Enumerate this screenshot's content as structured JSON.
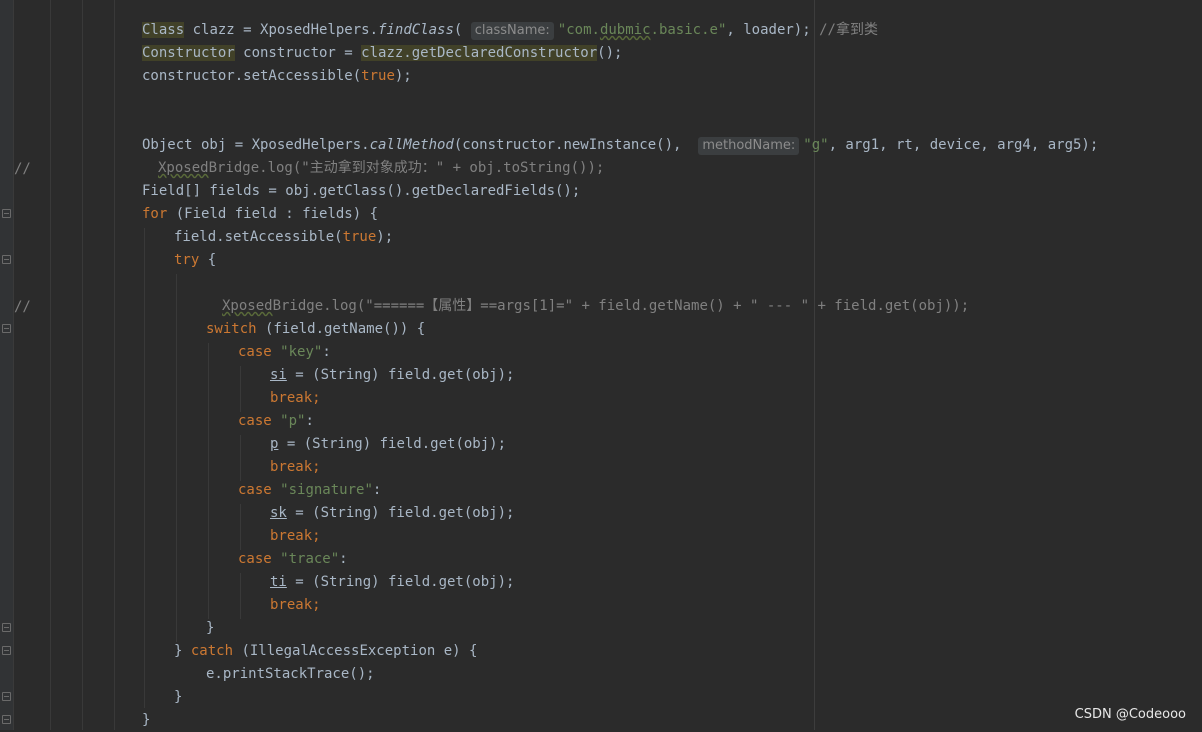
{
  "editor": {
    "gutter_comments": [
      "//",
      "//"
    ],
    "lines": {
      "l1": {
        "t1": "Class",
        "t2": " clazz = XposedHelpers.",
        "t3": "findClass",
        "t4": "(",
        "hint": "className:",
        "t5": "\"com.",
        "t6": "dubmic",
        ".basic.e\"": "",
        "t7": ".basic.e\"",
        "t8": ", loader); ",
        "t9": "//拿到类"
      },
      "l2": {
        "t1": "Constructor",
        "t2": " constructor = ",
        "t3": "clazz.getDeclaredConstructor",
        "t4": "();"
      },
      "l3": {
        "t1": "constructor.setAccessible(",
        "t2": "true",
        "t3": ");"
      },
      "l4": {
        "t1": "Object obj = XposedHelpers.",
        "t2": "callMethod",
        "t3": "(constructor.newInstance(), ",
        "hint": "methodName:",
        "t4": "\"g\"",
        "t5": ", arg1, rt, device, arg4, arg5);"
      },
      "l5": {
        "t1": "Xposed",
        "t2": "Bridge.log(\"主动拿到对象成功：\" + obj.toString());"
      },
      "l6": {
        "t1": "Field[] fields = obj.getClass().getDeclaredFields();"
      },
      "l7": {
        "t1": "for",
        "t2": " (Field field : fields) {"
      },
      "l8": {
        "t1": "field.setAccessible(",
        "t2": "true",
        "t3": ");"
      },
      "l9": {
        "t1": "try",
        "t2": " {"
      },
      "l10": {
        "t1": "Xposed",
        "t2": "Bridge.log(\"======【属性】==args[1]=\" + field.getName() + \" --- \" + field.get(obj));"
      },
      "l11": {
        "t1": "switch",
        "t2": " (field.getName()) {"
      },
      "l12": {
        "t1": "case ",
        "t2": "\"key\"",
        "t3": ":"
      },
      "l13": {
        "t1": "si",
        "t2": " = (String) field.get(obj);"
      },
      "l14": {
        "t1": "break;"
      },
      "l15": {
        "t1": "case ",
        "t2": "\"p\"",
        "t3": ":"
      },
      "l16": {
        "t1": "p",
        "t2": " = (String) field.get(obj);"
      },
      "l17": {
        "t1": "break;"
      },
      "l18": {
        "t1": "case ",
        "t2": "\"signature\"",
        "t3": ":"
      },
      "l19": {
        "t1": "sk",
        "t2": " = (String) field.get(obj);"
      },
      "l20": {
        "t1": "break;"
      },
      "l21": {
        "t1": "case ",
        "t2": "\"trace\"",
        "t3": ":"
      },
      "l22": {
        "t1": "ti",
        "t2": " = (String) field.get(obj);"
      },
      "l23": {
        "t1": "break;"
      },
      "l24": {
        "t1": "}"
      },
      "l25": {
        "t1": "} ",
        "t2": "catch",
        "t3": " (IllegalAccessException e) {"
      },
      "l26": {
        "t1": "e.printStackTrace();"
      },
      "l27": {
        "t1": "}"
      },
      "l28": {
        "t1": "}"
      }
    }
  },
  "watermark": "CSDN @Codeooo",
  "colors": {
    "background": "#2b2b2b",
    "keyword": "#cc7832",
    "string": "#6a8759",
    "comment": "#808080",
    "text": "#a9b7c6"
  }
}
